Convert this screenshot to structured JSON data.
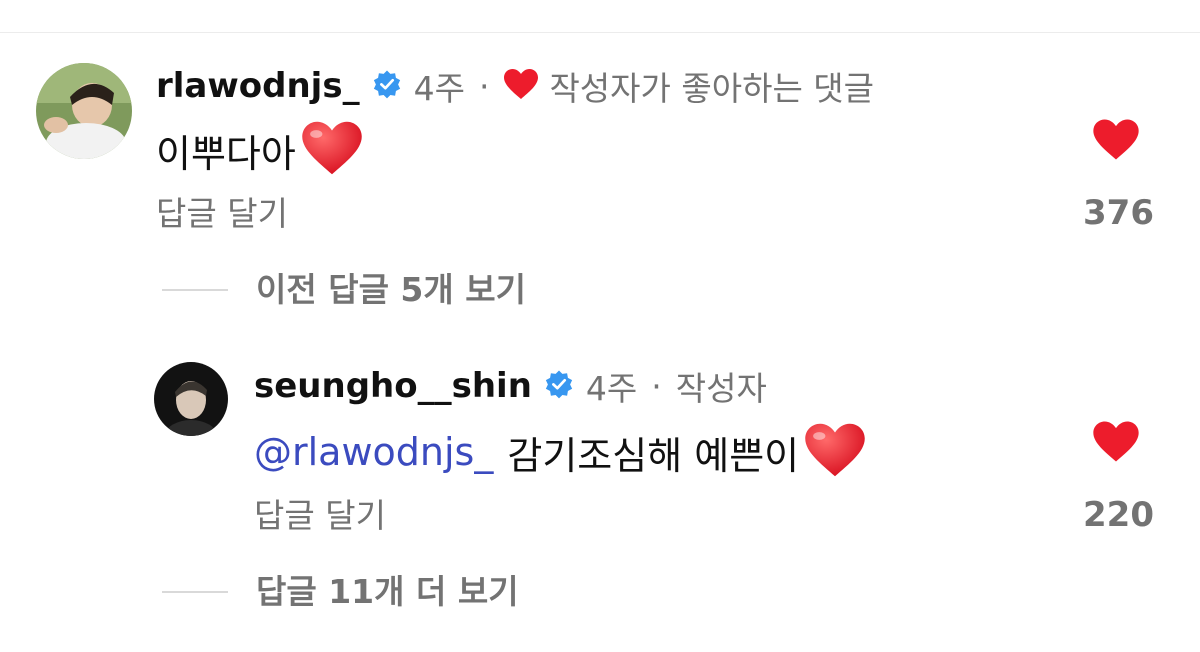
{
  "comments": [
    {
      "username": "rlawodnjs_",
      "age": "4주",
      "separator": "·",
      "author_badge": "작성자가 좋아하는 댓글",
      "text": "이뿌다아",
      "emoji": "❤️",
      "reply_label": "답글 달기",
      "like_count": "376",
      "avatar_icon": "profile-photo"
    },
    {
      "username": "seungho__shin",
      "age": "4주",
      "separator": "·",
      "author_badge": "작성자",
      "mention": "@rlawodnjs_",
      "text": "감기조심해 예쁜이",
      "emoji": "❤️",
      "reply_label": "답글 달기",
      "like_count": "220",
      "avatar_icon": "profile-photo"
    }
  ],
  "view_previous_replies": "이전 답글 5개 보기",
  "view_more_replies": "답글 11개 더 보기",
  "colors": {
    "heart": "#ed1c2c",
    "verified": "#3897f0",
    "mention": "#3b4bbf",
    "meta": "#737373"
  }
}
